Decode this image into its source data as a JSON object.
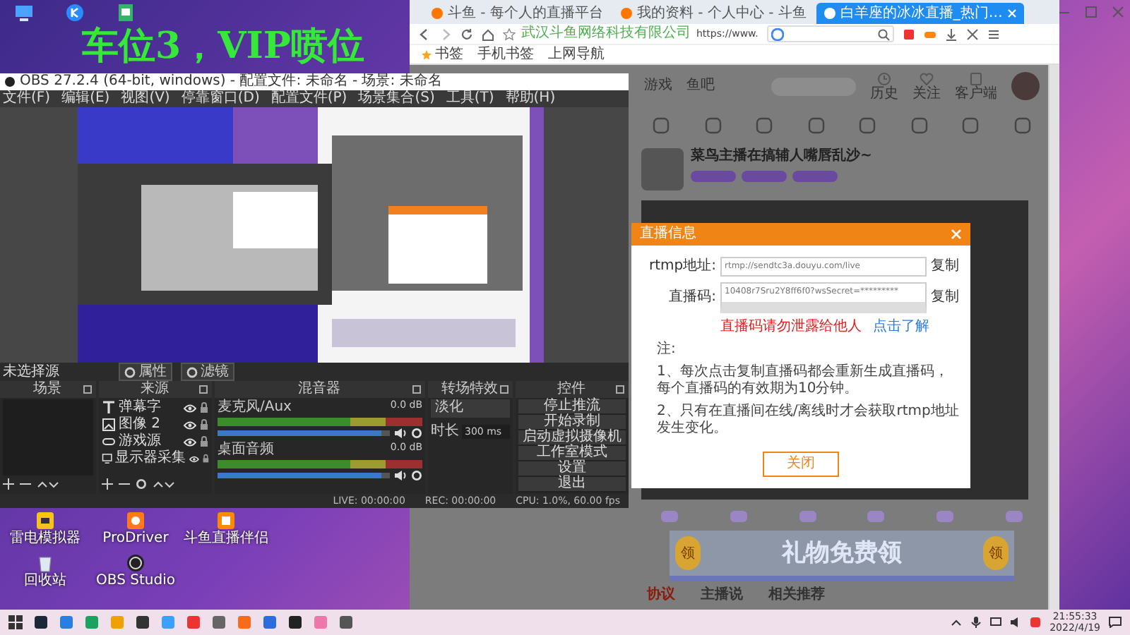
{
  "overlay_caption": "车位3，VIP喷位",
  "desktop_icons": [
    {
      "kind": "emulator",
      "label": "雷电模拟器"
    },
    {
      "kind": "driver",
      "label": "ProDriver"
    },
    {
      "kind": "stream",
      "label": "斗鱼直播伴侣"
    },
    {
      "kind": "bin",
      "label": "回收站"
    },
    {
      "kind": "obs",
      "label": "OBS Studio"
    }
  ],
  "browser": {
    "tabs": [
      {
        "title": "斗鱼 - 每个人的直播平台",
        "selected": false
      },
      {
        "title": "我的资料 - 个人中心 - 斗鱼",
        "selected": false
      },
      {
        "title": "白羊座的冰冰直播_热门…",
        "selected": true
      }
    ],
    "site": "武汉斗鱼网络科技有限公司",
    "url": "https://www.",
    "bookmarks": [
      "书签",
      "手机书签",
      "上网导航"
    ],
    "nav": [
      "游戏",
      "鱼吧"
    ],
    "header_icons": [
      {
        "kind": "history",
        "label": "历史"
      },
      {
        "kind": "follow",
        "label": "关注"
      },
      {
        "kind": "client",
        "label": "客户端"
      }
    ],
    "stream_title": "菜鸟主播在搞辅人嘴唇乱沙~",
    "banner": {
      "badges": [
        "领",
        "领"
      ],
      "text": "礼物免费领"
    },
    "page_tabs": [
      {
        "label": "协议",
        "selected": true
      },
      {
        "label": "主播说",
        "selected": false
      },
      {
        "label": "相关推荐",
        "selected": false
      }
    ]
  },
  "dialog": {
    "title": "直播信息",
    "fields": [
      {
        "label": "rtmp地址:",
        "value": "rtmp://sendtc3a.douyu.com/live",
        "action": "复制"
      },
      {
        "label": "直播码:",
        "value": "10408r7Sru2Y8ff6f0?wsSecret=*********",
        "action": "复制"
      }
    ],
    "warning": "直播码请勿泄露给他人",
    "link": "点击了解",
    "notes": [
      "注:",
      "1、每次点击复制直播码都会重新生成直播码，每个直播码的有效期为10分钟。",
      "2、只有在直播间在线/离线时才会获取rtmp地址发生变化。"
    ],
    "button": "关闭"
  },
  "obs": {
    "title": "OBS 27.2.4 (64-bit, windows) - 配置文件: 未命名 - 场景: 未命名",
    "menu": [
      "文件(F)",
      "编辑(E)",
      "视图(V)",
      "停靠窗口(D)",
      "配置文件(P)",
      "场景集合(S)",
      "工具(T)",
      "帮助(H)"
    ],
    "selection": "未选择源",
    "source_buttons": [
      "属性",
      "滤镜"
    ],
    "docks": [
      "场景",
      "来源",
      "混音器",
      "转场特效",
      "控件"
    ],
    "sources": [
      {
        "kind": "text",
        "name": "弹幕字"
      },
      {
        "kind": "image",
        "name": "图像 2"
      },
      {
        "kind": "game",
        "name": "游戏源"
      },
      {
        "kind": "display",
        "name": "显示器采集"
      }
    ],
    "mixer": [
      {
        "name": "麦克风/Aux",
        "reading": "0.0 dB",
        "level": 0.95
      },
      {
        "name": "桌面音频",
        "reading": "0.0 dB",
        "level": 0.95
      }
    ],
    "transition": {
      "value": "淡化",
      "duration_label": "时长",
      "duration": "300 ms"
    },
    "controls": [
      "停止推流",
      "开始录制",
      "启动虚拟摄像机",
      "工作室模式",
      "设置",
      "退出"
    ],
    "status": {
      "live": "LIVE: 00:00:00",
      "rec": "REC: 00:00:00",
      "cpu": "CPU: 1.0%, 60.00 fps"
    }
  },
  "taskbar": {
    "time": "21:55:33",
    "date": "2022/4/19"
  }
}
